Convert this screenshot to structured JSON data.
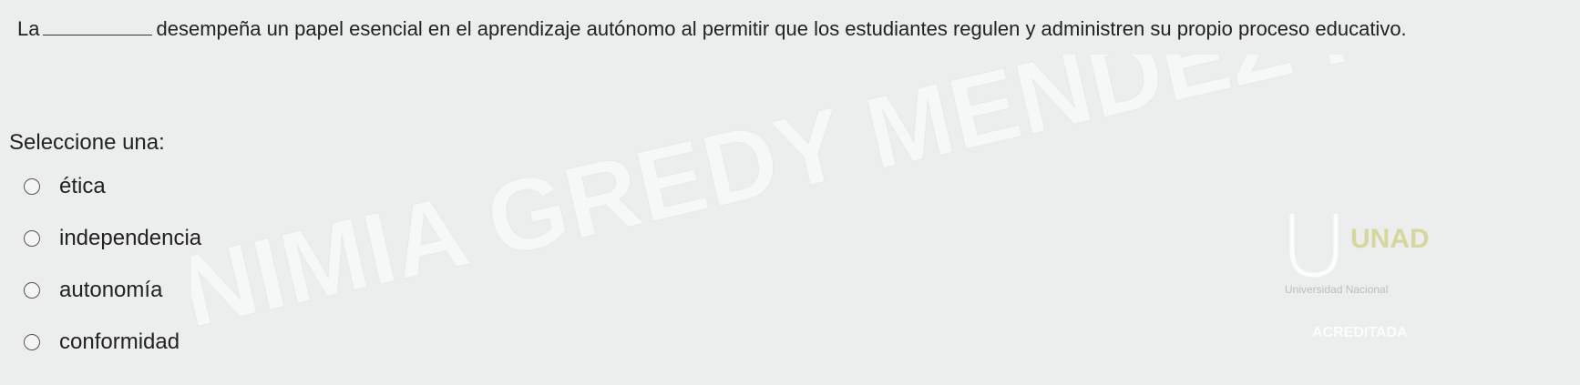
{
  "question": {
    "prefix": "La",
    "suffix": "desempeña un papel esencial en el aprendizaje autónomo al permitir que los estudiantes regulen y administren su propio proceso educativo."
  },
  "prompt": "Seleccione una:",
  "options": [
    {
      "label": "ética"
    },
    {
      "label": "independencia"
    },
    {
      "label": "autonomía"
    },
    {
      "label": "conformidad"
    }
  ],
  "watermark": {
    "text": "NIMIA GREDY MENDEZ RENUMA",
    "color": "#ffffff"
  },
  "logo": {
    "name": "UNAD",
    "subtitle": "Universidad Nacional",
    "badge": "ACREDITADA",
    "accent": "#c8c86a"
  }
}
